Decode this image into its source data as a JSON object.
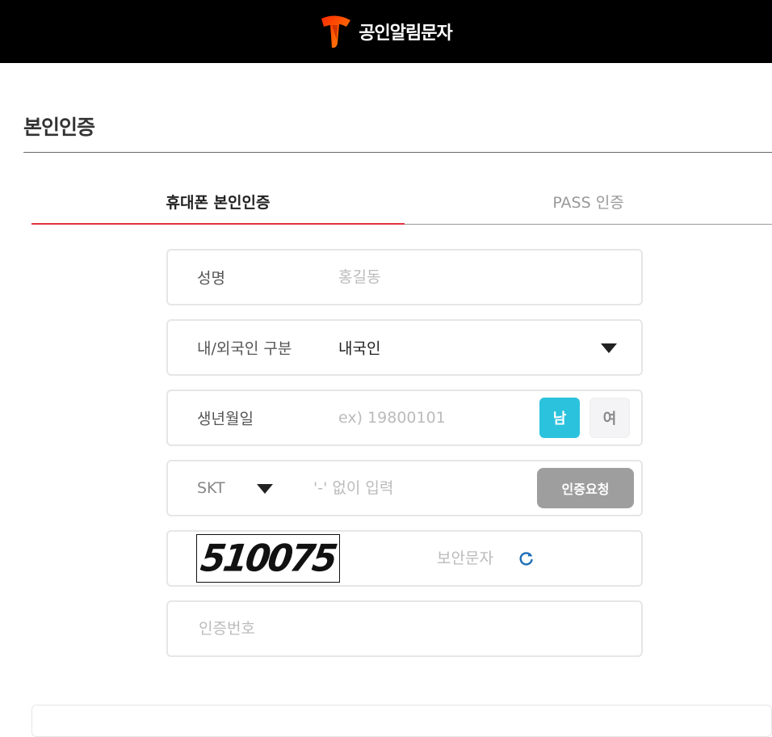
{
  "header": {
    "brand_name": "공인알림문자",
    "logo_icon": "t-logo-icon",
    "logo_colors": [
      "#ff3b00",
      "#ff8a00"
    ]
  },
  "page": {
    "title": "본인인증"
  },
  "tabs": [
    {
      "label": "휴대폰 본인인증",
      "active": true
    },
    {
      "label": "PASS 인증",
      "active": false
    }
  ],
  "form": {
    "name": {
      "label": "성명",
      "value": "",
      "placeholder": "홍길동"
    },
    "nationality": {
      "label": "내/외국인 구분",
      "selected": "내국인"
    },
    "birth": {
      "label": "생년월일",
      "value": "",
      "placeholder": "ex) 19800101",
      "male_label": "남",
      "female_label": "여",
      "selected_gender": "남"
    },
    "phone": {
      "carrier": "SKT",
      "value": "",
      "placeholder": "'-' 없이 입력",
      "request_button": "인증요청"
    },
    "captcha": {
      "code": "510075",
      "value": "",
      "placeholder": "보안문자",
      "refresh_icon": "refresh-icon"
    },
    "verification": {
      "label": "인증번호",
      "value": ""
    }
  },
  "colors": {
    "accent_red": "#e1343f",
    "gender_active": "#2bc2dd",
    "button_gray": "#9e9e9e",
    "refresh_blue": "#1e6fb8"
  }
}
